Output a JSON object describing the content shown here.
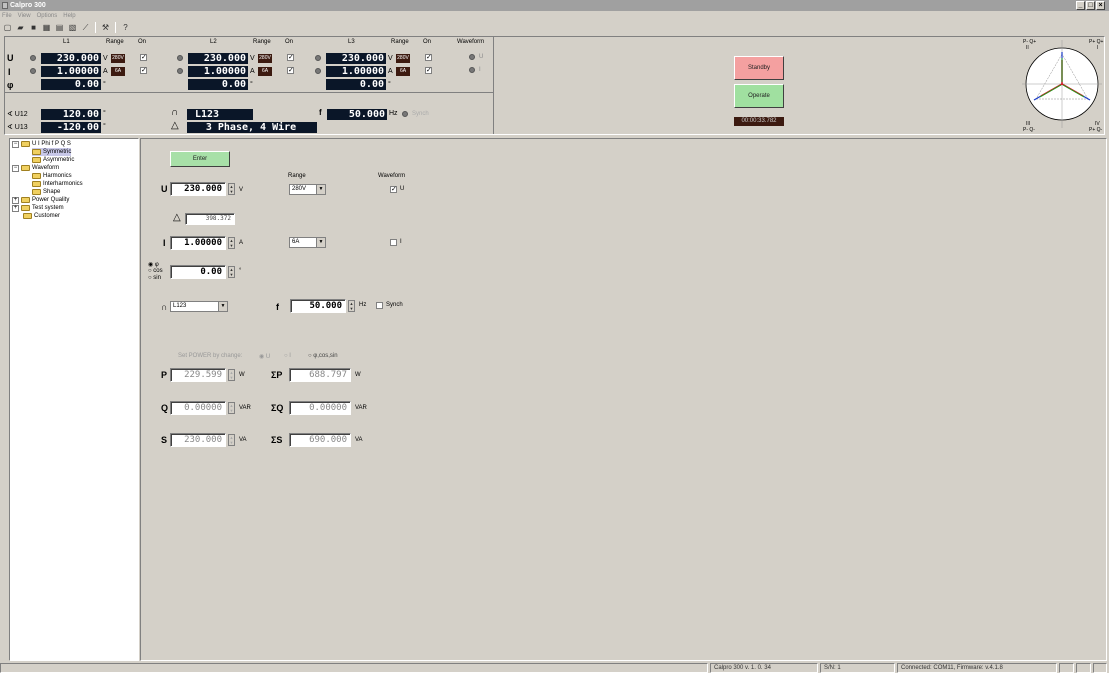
{
  "app": {
    "title": "Calpro 300"
  },
  "menu": [
    "File",
    "View",
    "Options",
    "Help"
  ],
  "phases": [
    {
      "name": "L1",
      "range_label": "Range",
      "on_label": "On",
      "u": "230.000",
      "u_unit": "V",
      "u_range": "280V",
      "i": "1.00000",
      "i_unit": "A",
      "i_range": "6A",
      "phi": "0.00",
      "phi_unit": "°"
    },
    {
      "name": "L2",
      "range_label": "Range",
      "on_label": "On",
      "u": "230.000",
      "u_unit": "V",
      "u_range": "280V",
      "i": "1.00000",
      "i_unit": "A",
      "i_range": "6A",
      "phi": "0.00",
      "phi_unit": "°"
    },
    {
      "name": "L3",
      "range_label": "Range",
      "on_label": "On",
      "u": "230.000",
      "u_unit": "V",
      "u_range": "280V",
      "i": "1.00000",
      "i_unit": "A",
      "i_range": "6A",
      "phi": "0.00",
      "phi_unit": "°"
    }
  ],
  "row_labels": {
    "u": "U",
    "i": "I",
    "phi": "φ"
  },
  "waveform": {
    "label": "Waveform",
    "u": "U",
    "i": "I"
  },
  "angles": {
    "u12_label": "∢ U12",
    "u12": "120.00",
    "u13_label": "∢ U13",
    "u13": "-120.00",
    "unit": "°"
  },
  "sequence": {
    "value": "L123",
    "mode": "3 Phase, 4 Wire"
  },
  "freq": {
    "label": "f",
    "value": "50.000",
    "unit": "Hz",
    "synch": "Synch"
  },
  "control": {
    "standby": "Standby",
    "operate": "Operate",
    "timer": "00:00:33.782"
  },
  "phasor": {
    "q1": "P- Q+",
    "q1b": "II",
    "q2": "P+ Q+",
    "q2b": "I",
    "q3": "III",
    "q3b": "P- Q-",
    "q4": "P+ Q-",
    "q4b": "IV"
  },
  "tree": {
    "root": "U I Phi f P Q S",
    "symmetric": "Symmetric",
    "asymmetric": "Asymmetric",
    "waveform": "Waveform",
    "harmonics": "Harmonics",
    "interharmonics": "Interharmonics",
    "shape": "Shape",
    "power_quality": "Power Quality",
    "test_system": "Test system",
    "customer": "Customer"
  },
  "form": {
    "enter": "Enter",
    "range_header": "Range",
    "waveform_header": "Waveform",
    "u_label": "U",
    "u_value": "230.000",
    "u_unit": "V",
    "u_range": "280V",
    "u_wave": "U",
    "delta_value": "398.372",
    "i_label": "I",
    "i_value": "1.00000",
    "i_unit": "A",
    "i_range": "6A",
    "i_wave": "I",
    "phi_opt": "φ",
    "cos_opt": "cos",
    "sin_opt": "sin",
    "phi_value": "0.00",
    "phi_unit": "°",
    "seq_value": "L123",
    "f_label": "f",
    "f_value": "50.000",
    "f_unit": "Hz",
    "synch": "Synch",
    "set_power": "Set POWER by change:",
    "opt_u": "U",
    "opt_i": "I",
    "opt_phi": "φ,cos,sin",
    "p_label": "P",
    "p_value": "229.599",
    "p_unit": "W",
    "sp_label": "ΣP",
    "sp_value": "688.797",
    "sp_unit": "W",
    "q_label": "Q",
    "q_value": "0.00000",
    "q_unit": "VAR",
    "sq_label": "ΣQ",
    "sq_value": "0.00000",
    "sq_unit": "VAR",
    "s_label": "S",
    "s_value": "230.000",
    "s_unit": "VA",
    "ss_label": "ΣS",
    "ss_value": "690.000",
    "ss_unit": "VA"
  },
  "status": {
    "version": "Calpro 300 v. 1. 0. 34",
    "sn": "S/N: 1",
    "connection": "Connected: COM11,  Firmware: v.4.1.8"
  }
}
